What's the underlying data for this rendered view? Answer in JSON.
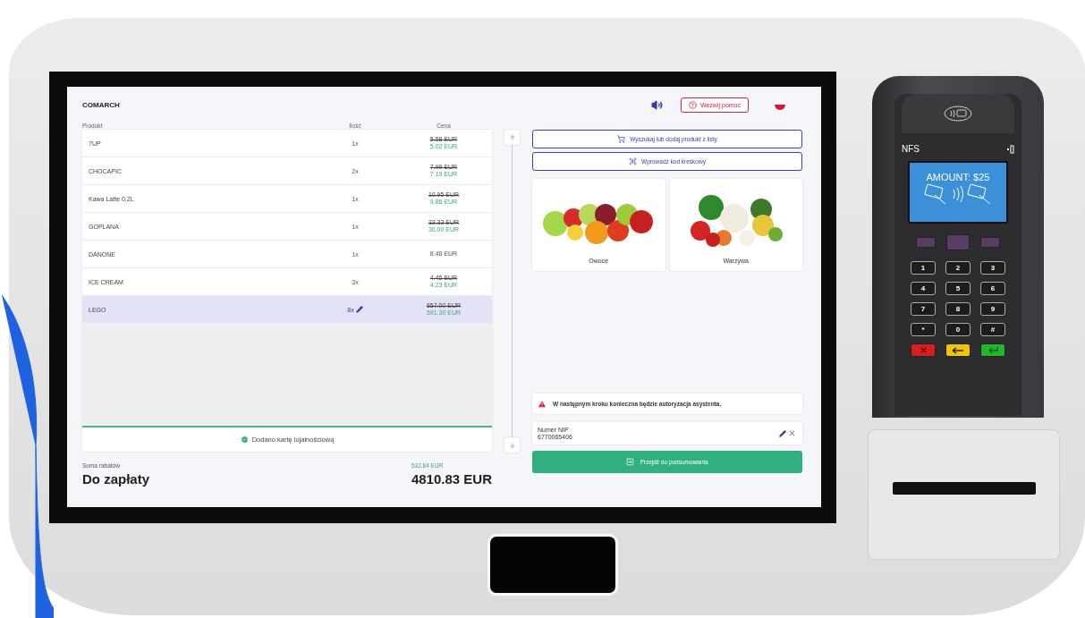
{
  "header": {
    "brand": "COMARCH",
    "help_button": "Wezwij pomoc"
  },
  "cart": {
    "columns": [
      "Produkt",
      "Ilość",
      "Cena"
    ],
    "rows": [
      {
        "name": "7UP",
        "quantity": "1x",
        "old_price": "5.58 EUR",
        "price": "5.02 EUR",
        "selected": false
      },
      {
        "name": "CHOCAPIC",
        "quantity": "2x",
        "old_price": "7.99 EUR",
        "price": "7.19 EUR",
        "selected": false
      },
      {
        "name": "Kawa Latte 0,2L",
        "quantity": "1x",
        "old_price": "10.95 EUR",
        "price": "9.86 EUR",
        "selected": false
      },
      {
        "name": "GOPLANA",
        "quantity": "1x",
        "old_price": "33.33 EUR",
        "price": "30.00 EUR",
        "selected": false
      },
      {
        "name": "DANONE",
        "quantity": "1x",
        "price": "8.48 EUR",
        "selected": false
      },
      {
        "name": "ICE CREAM",
        "quantity": "3x",
        "old_price": "4.45 EUR",
        "price": "4.23 EUR",
        "selected": false
      },
      {
        "name": "LEGO",
        "quantity": "8x",
        "old_price": "657.00 EUR",
        "price": "591.30 EUR",
        "selected": true
      }
    ],
    "loyalty_message": "Dodano kartę lojalnościową"
  },
  "summary": {
    "discount_label": "Suma rabatów",
    "discount_value": "532.84 EUR",
    "total_label": "Do zapłaty",
    "total_value": "4810.83 EUR"
  },
  "actions": [
    {
      "kind": "cart",
      "label": "Wyszukaj lub dodaj produkt z listy"
    },
    {
      "kind": "barcode",
      "label": "Wprowadź kod kreskowy"
    }
  ],
  "categories": [
    {
      "kind": "fruit",
      "label": "Owoce"
    },
    {
      "kind": "vegetable",
      "label": "Warzywa"
    }
  ],
  "warning": "W następnym kroku konieczna będzie autoryzacja asystenta.",
  "nip": {
    "label": "Numer NIP",
    "value": "6770065406"
  },
  "proceed_button": "Przejdź do podsumowania",
  "terminal": {
    "brand": "NFS",
    "display": "AMOUNT: $25",
    "keys": [
      "1",
      "2",
      "3",
      "4",
      "5",
      "6",
      "7",
      "8",
      "9",
      "*",
      "0",
      "#"
    ],
    "action_keys": [
      {
        "kind": "cancel",
        "color": "#d91e1e"
      },
      {
        "kind": "back",
        "color": "#f2c500"
      },
      {
        "kind": "enter",
        "color": "#22b82a"
      }
    ]
  }
}
